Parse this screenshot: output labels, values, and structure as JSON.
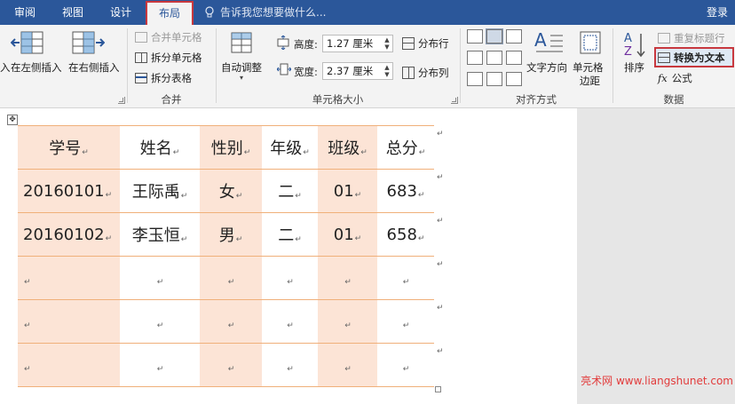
{
  "tabs": [
    {
      "id": "review",
      "label": "审阅",
      "active": false
    },
    {
      "id": "view",
      "label": "视图",
      "active": false
    },
    {
      "id": "design",
      "label": "设计",
      "active": false
    },
    {
      "id": "layout",
      "label": "布局",
      "active": true
    }
  ],
  "tell_me": {
    "placeholder": "告诉我您想要做什么..."
  },
  "login_label": "登录",
  "ribbon": {
    "rows_cols": {
      "insert_left_partial": "入",
      "insert_left": "在左侧插入",
      "insert_right": "在右侧插入"
    },
    "merge": {
      "merge_cells": "合并单元格",
      "split_cells": "拆分单元格",
      "split_table": "拆分表格",
      "group_label": "合并"
    },
    "cell_size": {
      "autofit": "自动调整",
      "height_label": "高度:",
      "height_value": "1.27 厘米",
      "width_label": "宽度:",
      "width_value": "2.37 厘米",
      "distribute_rows": "分布行",
      "distribute_cols": "分布列",
      "group_label": "单元格大小"
    },
    "alignment": {
      "text_direction": "文字方向",
      "cell_margins_1": "单元格",
      "cell_margins_2": "边距",
      "group_label": "对齐方式"
    },
    "data": {
      "sort": "排序",
      "repeat_header": "重复标题行",
      "convert_to_text": "转换为文本",
      "formula": "公式",
      "group_label": "数据"
    }
  },
  "table": {
    "rows": [
      [
        "学号",
        "姓名",
        "性别",
        "年级",
        "班级",
        "总分"
      ],
      [
        "20160101",
        "王际禹",
        "女",
        "二",
        "01",
        "683"
      ],
      [
        "20160102",
        "李玉恒",
        "男",
        "二",
        "01",
        "658"
      ],
      [
        "",
        "",
        "",
        "",
        "",
        ""
      ],
      [
        "",
        "",
        "",
        "",
        "",
        ""
      ],
      [
        "",
        "",
        "",
        "",
        "",
        ""
      ]
    ]
  },
  "watermark": "亮术网 www.liangshunet.com",
  "colors": {
    "title_bar": "#2b579a",
    "ribbon_bg": "#f3f3f3",
    "cell_shade": "#fce4d6",
    "row_border": "#f0b07a",
    "highlight_border": "#c8383e",
    "watermark": "#e23b3b"
  }
}
